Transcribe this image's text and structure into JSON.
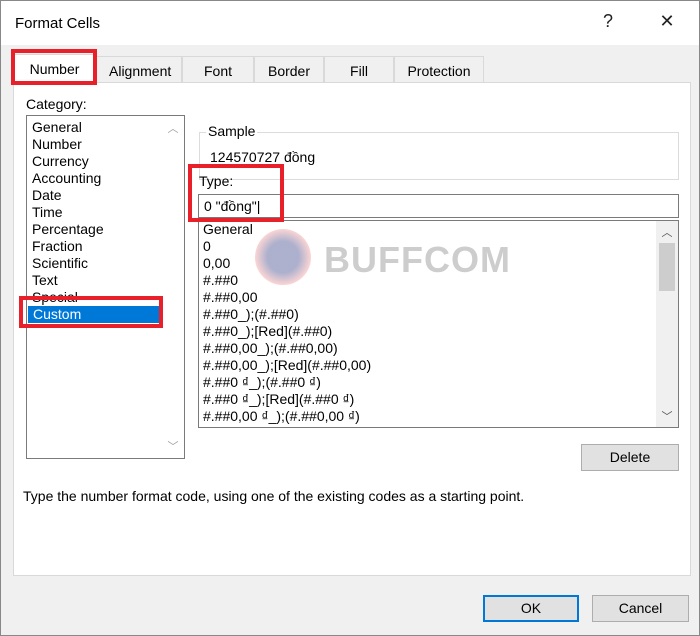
{
  "window": {
    "title": "Format Cells",
    "help": "?",
    "close": "✕"
  },
  "tabs": [
    "Number",
    "Alignment",
    "Font",
    "Border",
    "Fill",
    "Protection"
  ],
  "category": {
    "label": "Category:",
    "items": [
      "General",
      "Number",
      "Currency",
      "Accounting",
      "Date",
      "Time",
      "Percentage",
      "Fraction",
      "Scientific",
      "Text",
      "Special",
      "Custom"
    ],
    "selected": "Custom"
  },
  "sample": {
    "label": "Sample",
    "value": "124570727 đồng"
  },
  "type": {
    "label": "Type:",
    "value": "0 \"đồng\""
  },
  "formats": [
    "General",
    "0",
    "0,00",
    "#.##0",
    "#.##0,00",
    "#.##0_);(#.##0)",
    "#.##0_);[Red](#.##0)",
    "#.##0,00_);(#.##0,00)",
    "#.##0,00_);[Red](#.##0,00)",
    "#.##0 ₫_);(#.##0 ₫)",
    "#.##0 ₫_);[Red](#.##0 ₫)",
    "#.##0,00 ₫_);(#.##0,00 ₫)"
  ],
  "buttons": {
    "delete": "Delete",
    "ok": "OK",
    "cancel": "Cancel"
  },
  "description": "Type the number format code, using one of the existing codes as a starting point.",
  "watermark": "BUFFCOM",
  "colors": {
    "highlight": "#e8202a",
    "selection": "#0078d7"
  }
}
